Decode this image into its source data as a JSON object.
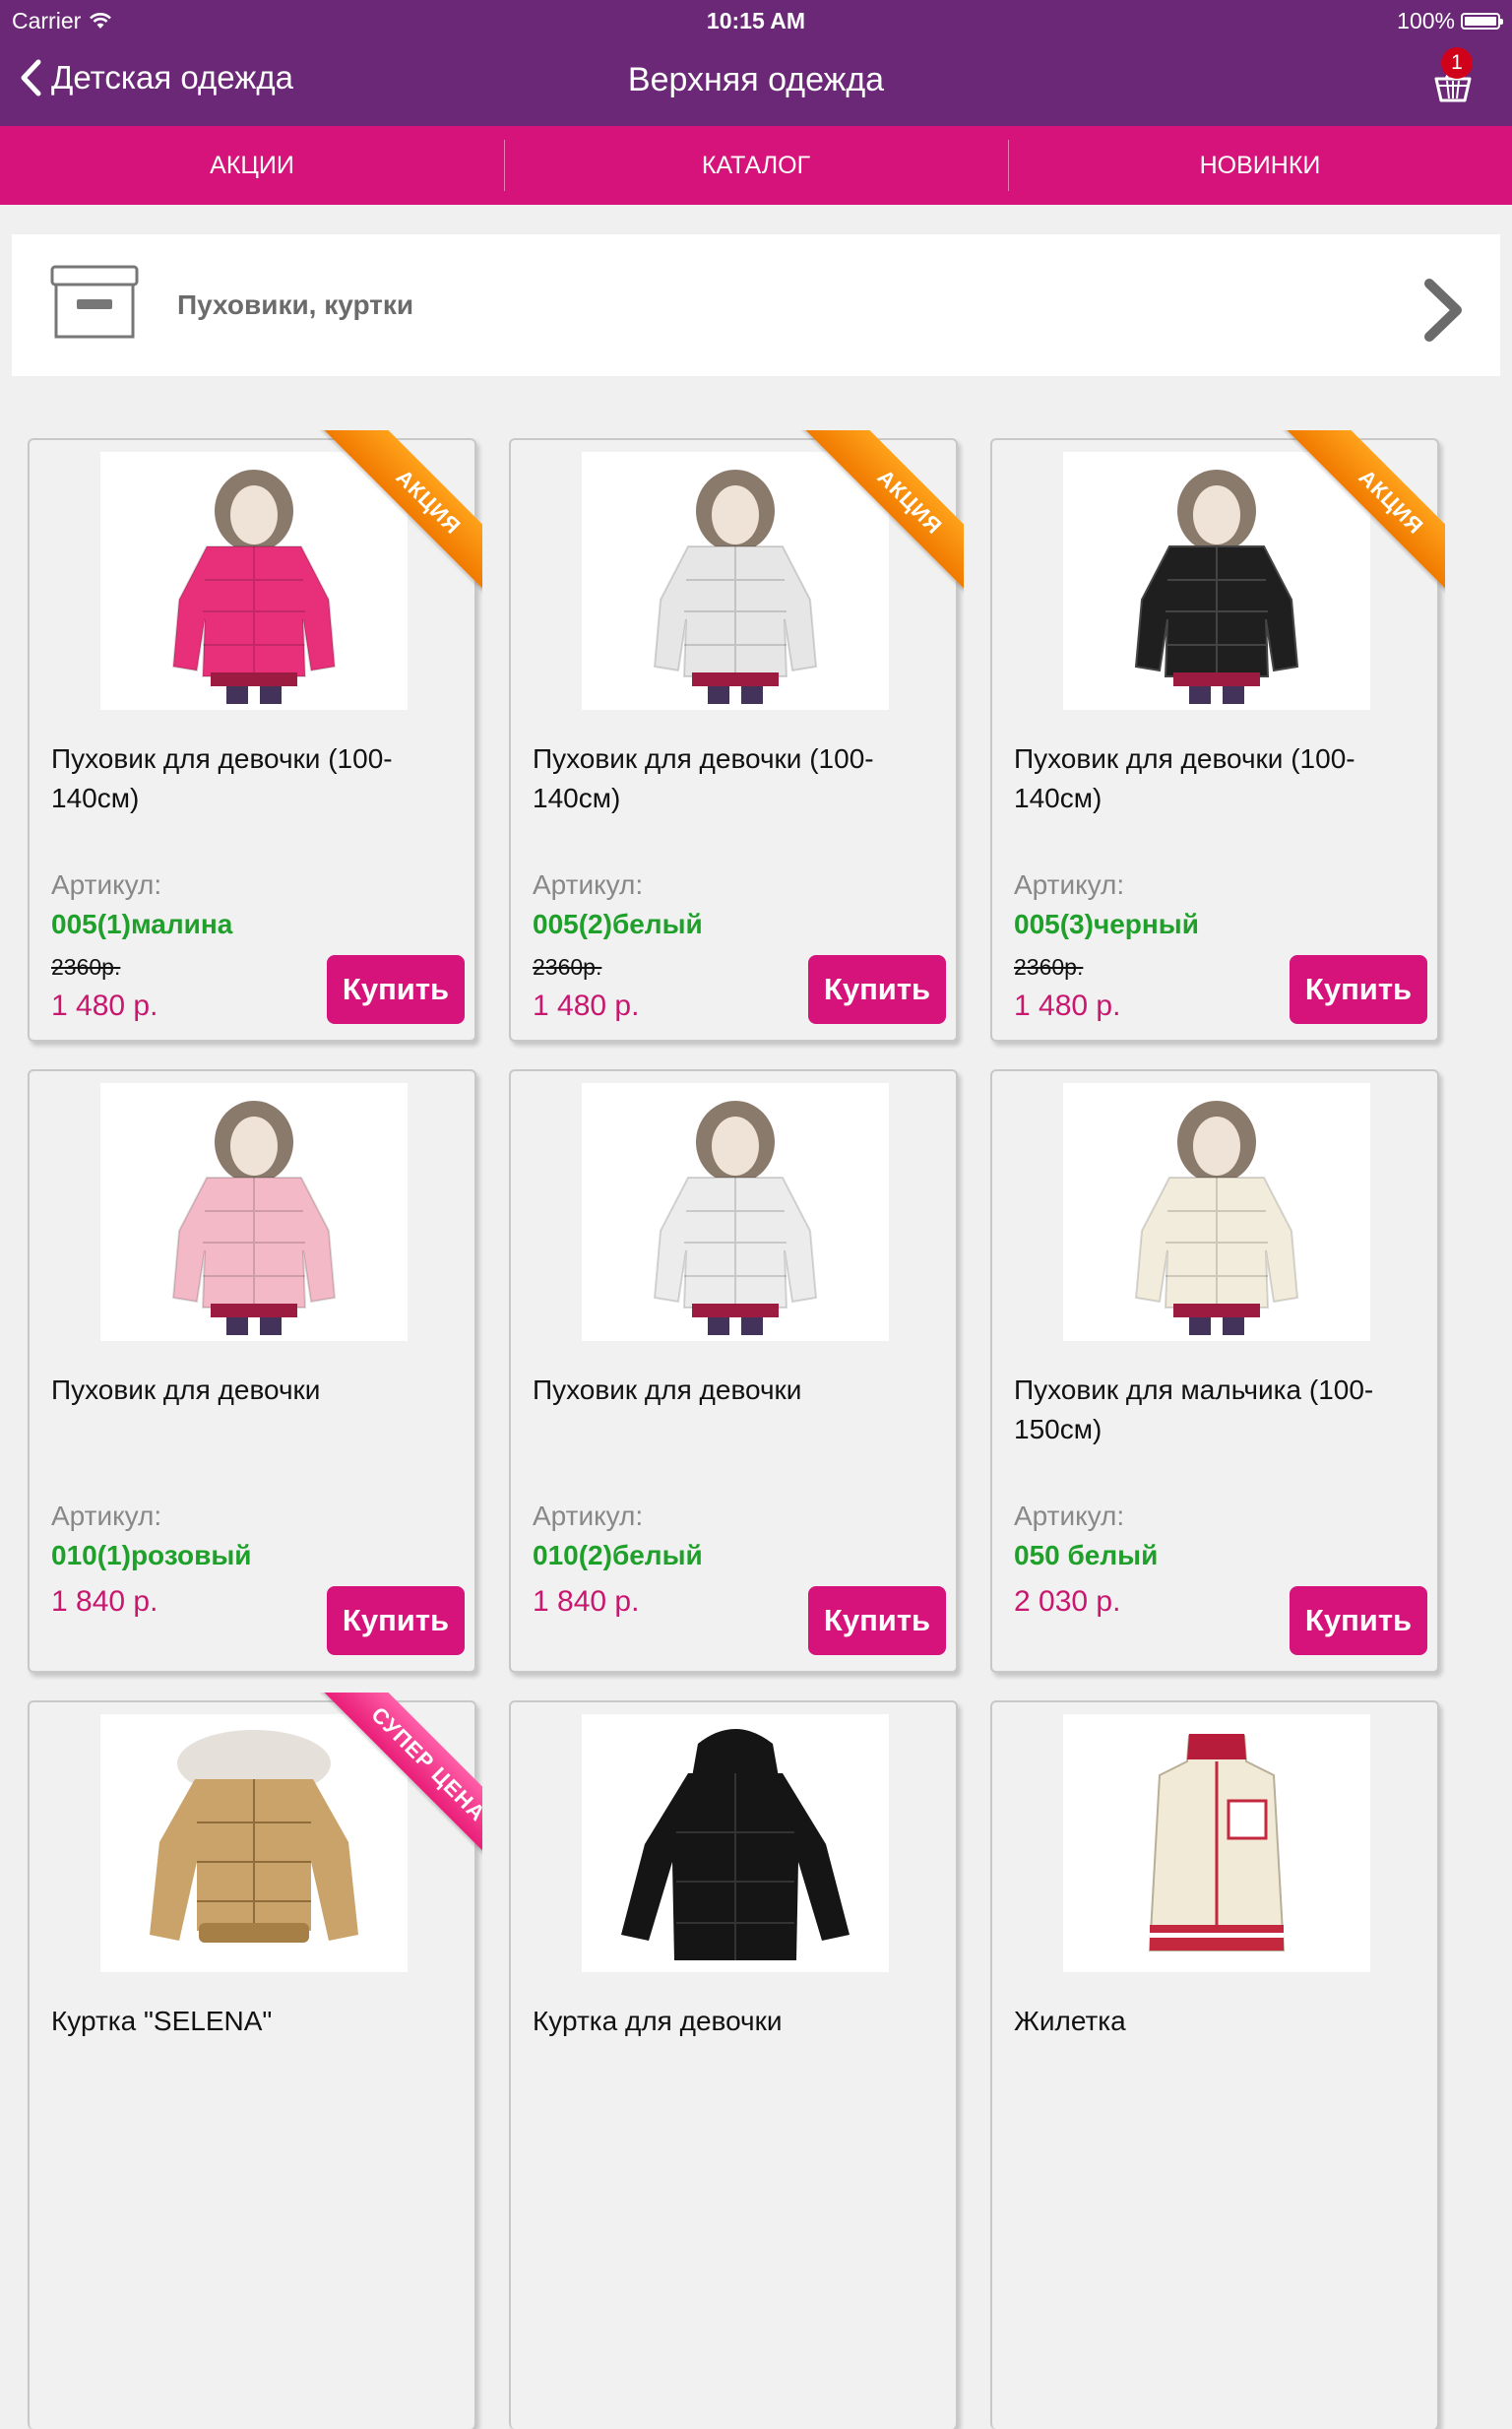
{
  "status_bar": {
    "carrier": "Carrier",
    "time": "10:15 AM",
    "battery": "100%"
  },
  "nav": {
    "back_label": "Детская одежда",
    "title": "Верхняя одежда",
    "cart_count": "1"
  },
  "tabs": [
    {
      "label": "АКЦИИ"
    },
    {
      "label": "КАТАЛОГ"
    },
    {
      "label": "НОВИНКИ"
    }
  ],
  "category": {
    "label": "Пуховики, куртки"
  },
  "sku_label": "Артикул:",
  "buy_label": "Купить",
  "products": [
    {
      "name": "Пуховик для девочки (100-140см)",
      "sku": "005(1)малина",
      "old_price": "2360р.",
      "price": "1 480 р.",
      "ribbon": "АКЦИЯ",
      "color": "#e8307a"
    },
    {
      "name": "Пуховик для девочки (100-140см)",
      "sku": "005(2)белый",
      "old_price": "2360р.",
      "price": "1 480 р.",
      "ribbon": "АКЦИЯ",
      "color": "#e6e6e6"
    },
    {
      "name": "Пуховик для девочки (100-140см)",
      "sku": "005(3)черный",
      "old_price": "2360р.",
      "price": "1 480 р.",
      "ribbon": "АКЦИЯ",
      "color": "#1f1f1f"
    },
    {
      "name": "Пуховик для девочки",
      "sku": "010(1)розовый",
      "price": "1 840 р.",
      "color": "#f3b9c7"
    },
    {
      "name": "Пуховик для девочки",
      "sku": "010(2)белый",
      "price": "1 840 р.",
      "color": "#ececec"
    },
    {
      "name": "Пуховик для мальчика (100-150см)",
      "sku": "050 белый",
      "price": "2 030 р.",
      "color": "#f2ecdc"
    },
    {
      "name": "Куртка \"SELENA\"",
      "ribbon": "СУПЕР ЦЕНА",
      "color": "#c9a36a"
    },
    {
      "name": "Куртка для девочки",
      "color": "#151515"
    },
    {
      "name": "Жилетка",
      "color": "#f1ead6"
    }
  ]
}
